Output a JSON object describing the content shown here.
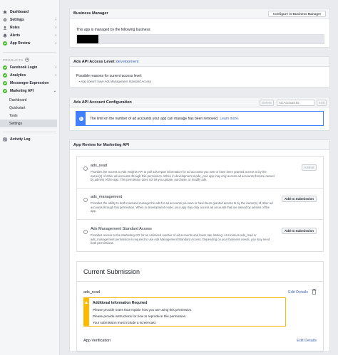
{
  "sidebar": {
    "items": [
      {
        "label": "Dashboard",
        "icon": "home-icon"
      },
      {
        "label": "Settings",
        "icon": "gear-icon"
      },
      {
        "label": "Roles",
        "icon": "roles-icon"
      },
      {
        "label": "Alerts",
        "icon": "bell-icon"
      },
      {
        "label": "App Review",
        "icon": "check-circle-icon"
      }
    ],
    "products_label": "PRODUCTS",
    "products": [
      {
        "label": "Facebook Login"
      },
      {
        "label": "Analytics"
      },
      {
        "label": "Messenger Expression"
      },
      {
        "label": "Marketing API"
      }
    ],
    "marketing_sub": [
      "Dashboard",
      "Quickstart",
      "Tools",
      "Settings"
    ],
    "activity_log": "Activity Log"
  },
  "business_manager": {
    "title": "Business Manager",
    "configure_button": "Configure in Business Manager",
    "managed_text": "This app is managed by the following business:"
  },
  "access_level": {
    "title_prefix": "Ads API Access Level: ",
    "level": "development",
    "reasons_heading": "Possible reasons for current access level:",
    "reason_1": "• App doesn't have Ads Management Standard Access"
  },
  "account_config": {
    "title": "Ads API Account Configuration",
    "delete_button": "Delete",
    "account_placeholder": "Ad Account ID",
    "add_button": "Add",
    "notice": "The limit on the number of ad accounts your app can manage has been removed.",
    "learn_more": "Learn more."
  },
  "app_review": {
    "title": "App Review for Marketing API",
    "permissions": [
      {
        "name": "ads_read",
        "desc": "Provides the access to Ads Insights API to pull ads report information for ad accounts you own or have been granted access to by the owner(s) of other ad accounts through this permission. When in development mode, your app may only access ad accounts that are owned by admins of the app. This permission does not let you update, purchase, or modify ads.",
        "action": "Added"
      },
      {
        "name": "ads_management",
        "desc": "Provides the ability to both read and manage the ads for ad accounts you own or have been granted access to by the owner(s) of other ad accounts through this permission. When in development mode, your app may only access ad accounts that are owned by admins of the app.",
        "action": "Add to Submission"
      },
      {
        "name": "Ads Management Standard Access",
        "desc": "Provides access to the Marketing API for an unlimited number of ad accounts and lower rate limiting. At minimum ads_read or ads_management permission is required to use Ads Management Standard Access. Depending on your business needs, you may need both permissions.",
        "action": "Add to Submission"
      }
    ]
  },
  "submission": {
    "title": "Current Submission",
    "item_name": "ads_read",
    "edit_details": "Edit Details",
    "warning_title": "Additional Information Required",
    "warning_lines": [
      "Please provide notes that explain how you are using this permission.",
      "Please provide instructions for how to reproduce this permission.",
      "Your submission must include a screencast."
    ],
    "verification": "App Verification",
    "verification_edit": "Edit Details"
  },
  "colors": {
    "accent": "#4267b2",
    "success": "#42b72a",
    "info": "#4080ff",
    "warning": "#ffba00"
  }
}
